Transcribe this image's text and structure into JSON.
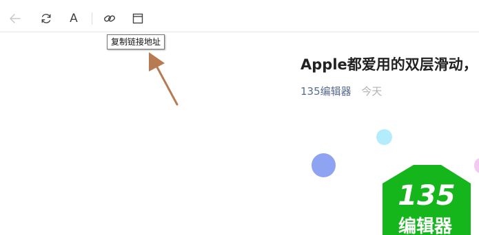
{
  "toolbar": {
    "buttons": [
      {
        "icon": "back-arrow-icon"
      },
      {
        "icon": "refresh-icon"
      },
      {
        "icon": "font-size-icon",
        "label": "A"
      },
      {
        "icon": "link-icon"
      },
      {
        "icon": "browser-window-icon"
      }
    ]
  },
  "tooltip": {
    "text": "复制链接地址"
  },
  "article": {
    "title": "Apple都爱用的双层滑动，",
    "author": "135编辑器",
    "date": "今天"
  },
  "logo": {
    "number": "135",
    "text": "编辑器",
    "color": "#15b51c"
  },
  "colors": {
    "accent_arrow": "#b87a52",
    "author_link": "#576b95",
    "bubble_blue": "#8ea3f2",
    "bubble_cyan": "#b3ecfa",
    "bubble_pink": "#f3c8f2"
  }
}
